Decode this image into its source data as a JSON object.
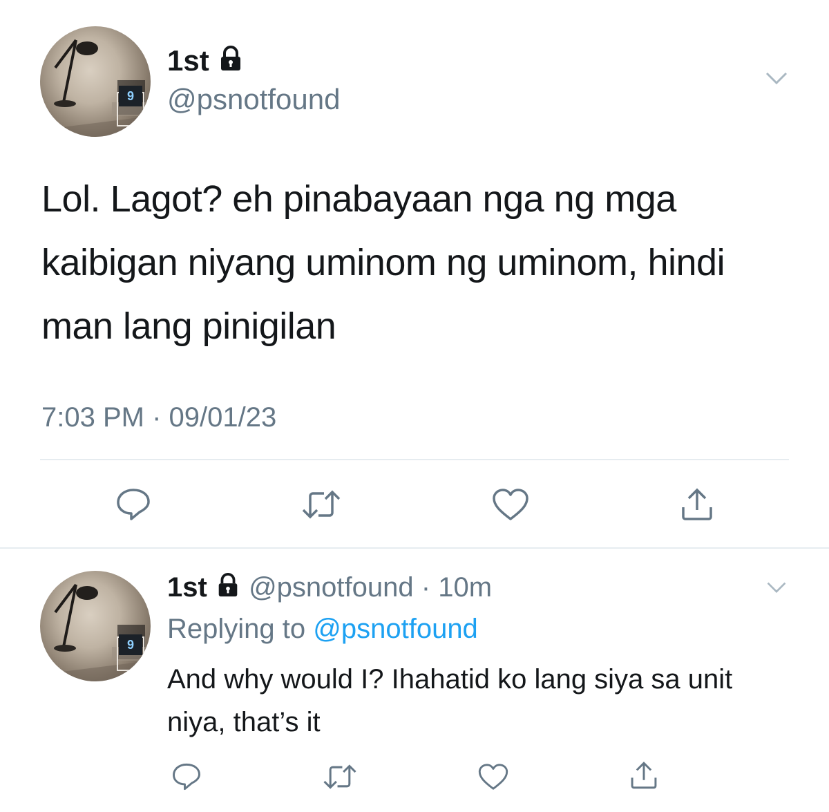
{
  "main_tweet": {
    "display_name": "1st",
    "handle": "@psnotfound",
    "text": "Lol. Lagot? eh pinabayaan nga ng mga kaibigan niyang uminom ng uminom, hindi man lang pinigilan",
    "timestamp": "7:03 PM · 09/01/23",
    "avatar_badge": "9",
    "icons": [
      "lock-icon",
      "chevron-down-icon",
      "reply-icon",
      "retweet-icon",
      "like-icon",
      "share-icon"
    ]
  },
  "reply_tweet": {
    "display_name": "1st",
    "handle": "@psnotfound",
    "separator": "·",
    "time_ago": "10m",
    "replying_to_label": "Replying to",
    "replying_to_handle": "@psnotfound",
    "text": "And why would I? Ihahatid ko lang siya sa unit niya, that’s it",
    "avatar_badge": "9",
    "icons": [
      "lock-icon",
      "chevron-down-icon",
      "reply-icon",
      "retweet-icon",
      "like-icon",
      "share-icon"
    ]
  },
  "colors": {
    "text": "#14171a",
    "secondary": "#657786",
    "link": "#1da1f2",
    "divider": "#e6ecf0"
  }
}
